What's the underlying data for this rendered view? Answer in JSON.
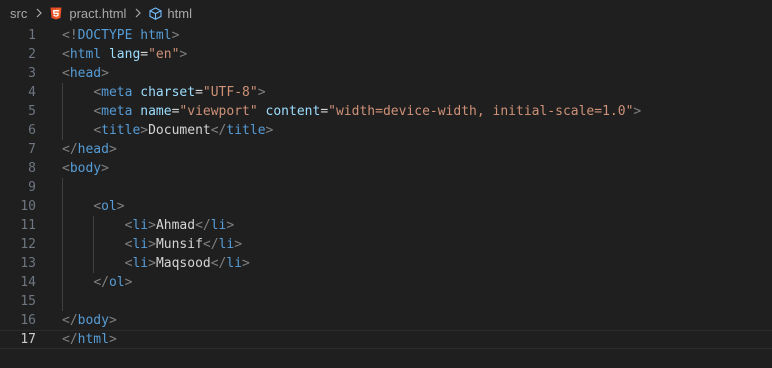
{
  "breadcrumb": {
    "folder": "src",
    "file": "pract.html",
    "symbol": "html"
  },
  "icons": {
    "file_icon": "html5-icon",
    "symbol_icon": "cube-icon",
    "separator_icon": "chevron-right-icon"
  },
  "colors": {
    "background": "#1f1f1f",
    "tag": "#569cd6",
    "punctuation": "#808080",
    "attribute": "#9cdcfe",
    "string": "#ce9178",
    "text": "#d4d4d4",
    "line_number": "#6e7681",
    "active_line_number": "#cccccc",
    "html5_icon": "#e44d26"
  },
  "editor": {
    "active_line": 17,
    "lines": [
      {
        "num": "1",
        "text": "<!DOCTYPE html>"
      },
      {
        "num": "2",
        "text": "<html lang=\"en\">"
      },
      {
        "num": "3",
        "text": "<head>"
      },
      {
        "num": "4",
        "text": "    <meta charset=\"UTF-8\">"
      },
      {
        "num": "5",
        "text": "    <meta name=\"viewport\" content=\"width=device-width, initial-scale=1.0\">"
      },
      {
        "num": "6",
        "text": "    <title>Document</title>"
      },
      {
        "num": "7",
        "text": "</head>"
      },
      {
        "num": "8",
        "text": "<body>"
      },
      {
        "num": "9",
        "text": ""
      },
      {
        "num": "10",
        "text": "    <ol>"
      },
      {
        "num": "11",
        "text": "        <li>Ahmad</li>"
      },
      {
        "num": "12",
        "text": "        <li>Munsif</li>"
      },
      {
        "num": "13",
        "text": "        <li>Maqsood</li>"
      },
      {
        "num": "14",
        "text": "    </ol>"
      },
      {
        "num": "15",
        "text": ""
      },
      {
        "num": "16",
        "text": "</body>"
      },
      {
        "num": "17",
        "text": "</html>"
      }
    ]
  }
}
